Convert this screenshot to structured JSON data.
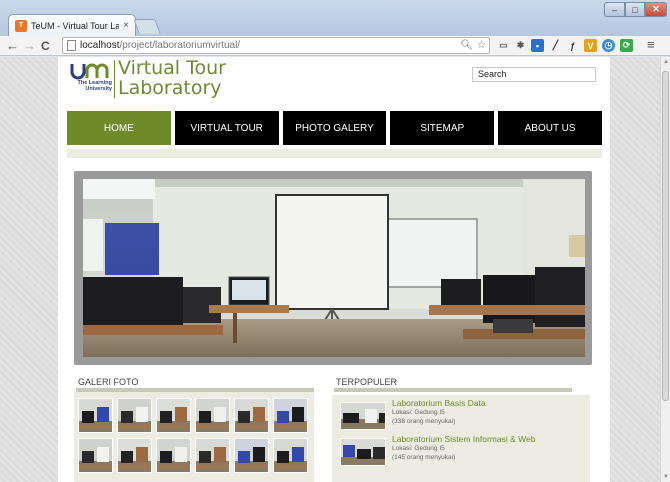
{
  "browser": {
    "tab_title": "TeUM - Virtual Tour Labo",
    "tab_close": "×",
    "favicon_text": "T",
    "url_host": "localhost",
    "url_path": "/project/laboratoriumvirtual/",
    "window_min": "–",
    "window_max": "□",
    "window_close": "✕",
    "back_glyph": "←",
    "forward_glyph": "→",
    "reload_glyph": "C",
    "menu_glyph": "≡"
  },
  "site": {
    "logo_tagline": "The Learning University",
    "logo_title_line1": "Virtual Tour",
    "logo_title_line2": "Laboratory",
    "search_value": "Search",
    "nav": [
      {
        "label": "HOME",
        "active": true
      },
      {
        "label": "VIRTUAL TOUR",
        "active": false
      },
      {
        "label": "PHOTO GALERY",
        "active": false
      },
      {
        "label": "SITEMAP",
        "active": false
      },
      {
        "label": "ABOUT US",
        "active": false
      }
    ],
    "gallery_title": "GALERI FOTO",
    "popular_title": "TERPOPULER",
    "popular": [
      {
        "name": "Laboratorium Basis Data",
        "location": "Lokasi: Gedung I5",
        "visitors": "(338 orang menyukai)"
      },
      {
        "name": "Laboratorium Sistem Informasi & Web",
        "location": "Lokasi: Gedung I5",
        "visitors": "(145 orang menyukai)"
      }
    ]
  },
  "colors": {
    "brand_green": "#6f8a2a",
    "nav_black": "#000000",
    "logo_blue": "#2b3f7a"
  },
  "icons": [
    "favicon-icon",
    "back-icon",
    "forward-icon",
    "reload-icon",
    "page-icon",
    "zoom-icon",
    "star-icon",
    "menu-icon"
  ]
}
